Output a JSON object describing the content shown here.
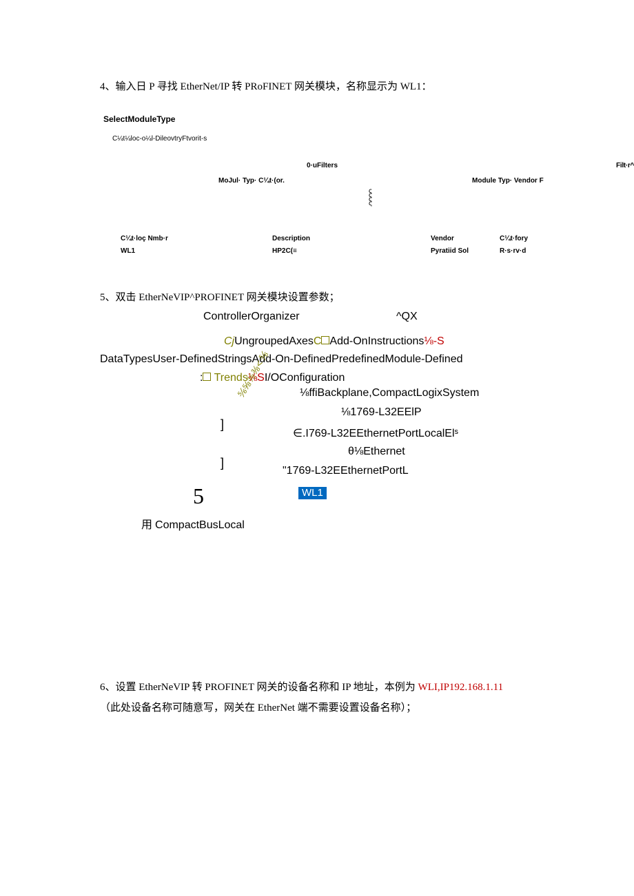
{
  "step4": {
    "text": "4、输入日 P 寻找 EtherNet/IP 转 PRoFINET 网关模块，名称显示为 WL1：",
    "dialog": {
      "title": "SelectModuleType",
      "sub": "C¼t¼loc-o¼l-DileovtryFtvorit-s",
      "filters_center": "0·uFilters",
      "filters_right": "Filt·r^",
      "type_left": "MoJul· Typ· C¼t·(or.",
      "type_right": "Module Typ· Vendor F",
      "headers": {
        "c1": "C¼t·loç Nmb·r",
        "c2": "Description",
        "c3": "Vendor",
        "c4": "C¼t·fory"
      },
      "row": {
        "c1": "WL1",
        "c2": "HP2C(≡",
        "c3": "Pyratiid Sol",
        "c4": "R·s·rv·d"
      }
    }
  },
  "step5": {
    "text": "5、双击 EtherNeVIP^PROFINET 网关模块设置参数；",
    "controller": "ControllerOrganizer",
    "qx": "^QX",
    "l1_a": "Cj",
    "l1_b": "UngroupedAxes",
    "l1_c": "C",
    "l1_d": "Add-OnInstructions",
    "l1_e": "⅛-S",
    "l1_f": "DataTypesUser-DefinedStringsAdd-On-DefinedPredefinedModule-Defined",
    "l2_a": ":",
    "l2_b": " Trends",
    "l2_c": "⅛S",
    "l2_d": "I/OConfiguration",
    "glyphs": "⅚⅝⅜⅜<⅚",
    "tt1": "⅛ffiBackplane,CompactLogixSystem",
    "tt2": "⅛1769-L32EElP",
    "tt3": "∈.I769-L32EEthernetPortLocalElˢ",
    "tt4": "θ⅛Ethernet",
    "tt5": "\"1769-L32EEthernetPortL",
    "wl1": "WL1",
    "compact_cjk": "用 ",
    "compact_latin": "CompactBusLocal"
  },
  "step6": {
    "line1_a": "6、设置 EtherNeVIP 转 PROFINET 网关的设备名称和 IP 地址，本例为 ",
    "line1_red": "WLI,IP192.168.1.11",
    "line2": "（此处设备名称可随意写，网关在 EtherNet 端不需要设置设备名称）；"
  }
}
